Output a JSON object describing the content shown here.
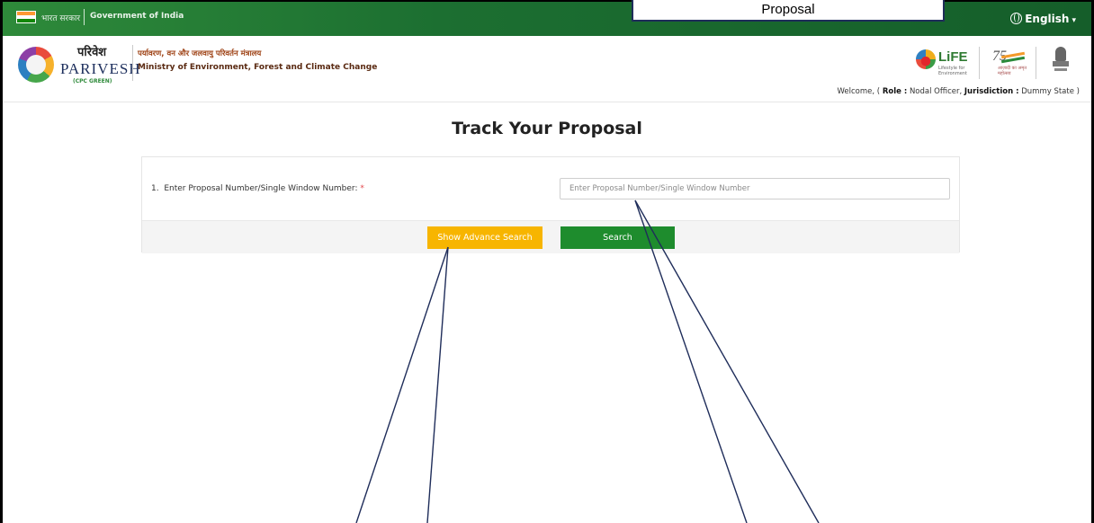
{
  "gov_bar": {
    "hindi_text": "भारत सरकार",
    "english_text": "Government of India",
    "language_label": "English",
    "language_icon": "globe-icon",
    "colors": {
      "bar_green": "#1c6f31"
    }
  },
  "callout": {
    "text": "Proposal"
  },
  "header": {
    "brand_hindi": "परिवेश",
    "brand_english": "PARIVESH",
    "brand_sub": "(CPC GREEN)",
    "ministry_hindi": "पर्यावरण, वन और जलवायु परिवर्तन मंत्रालय",
    "ministry_english": "Ministry of Environment, Forest and Climate Change",
    "life_logo_text": "LiFE",
    "life_logo_sub": "Lifestyle for Environment",
    "azadi_logo_sub": "आज़ादी का अमृत महोत्सव",
    "welcome_prefix": "Welcome, (",
    "role_label": "Role :",
    "role_value": "Nodal Officer,",
    "jurisdiction_label": "Jurisdiction :",
    "jurisdiction_value": "Dummy State",
    "welcome_suffix": ")"
  },
  "main": {
    "title": "Track Your Proposal",
    "field_number": "1.",
    "field_label": "Enter Proposal Number/Single Window Number:",
    "required_mark": "*",
    "input_placeholder": "Enter Proposal Number/Single Window Number",
    "input_value": "",
    "advance_button": "Show Advance Search",
    "search_button": "Search",
    "colors": {
      "advance": "#f7b500",
      "search": "#1e8c2d",
      "required": "#e4474b"
    }
  }
}
